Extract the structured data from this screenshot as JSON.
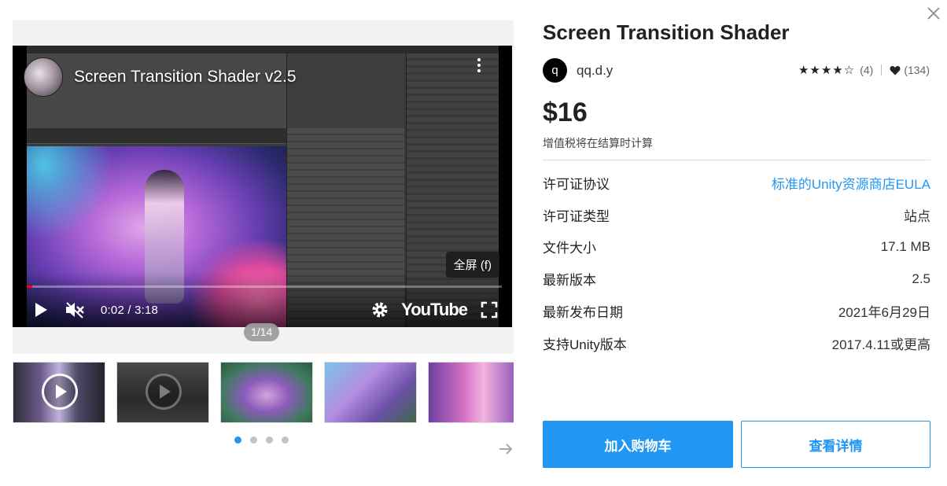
{
  "video": {
    "title": "Screen Transition Shader v2.5",
    "time": "0:02 / 3:18",
    "progress_fraction": 0.012,
    "brand": "YouTube",
    "fullscreen_tooltip": "全屏 (f)"
  },
  "gallery": {
    "counter": "1/14",
    "thumbnails": [
      {
        "kind": "video"
      },
      {
        "kind": "video"
      },
      {
        "kind": "image"
      },
      {
        "kind": "image"
      },
      {
        "kind": "image"
      }
    ],
    "page_dots": 4,
    "active_page": 0
  },
  "product": {
    "title": "Screen Transition Shader",
    "publisher_initial": "q",
    "publisher": "qq.d.y",
    "stars": "★★★★☆",
    "rating_count": "(4)",
    "favorites": "(134)",
    "price": "$16",
    "vat_note": "增值税将在结算时计算"
  },
  "specs": [
    {
      "key": "许可证协议",
      "value": "标准的Unity资源商店EULA",
      "link": true
    },
    {
      "key": "许可证类型",
      "value": "站点",
      "link": false
    },
    {
      "key": "文件大小",
      "value": "17.1 MB",
      "link": false
    },
    {
      "key": "最新版本",
      "value": "2.5",
      "link": false
    },
    {
      "key": "最新发布日期",
      "value": "2021年6月29日",
      "link": false
    },
    {
      "key": "支持Unity版本",
      "value": "2017.4.11或更高",
      "link": false
    }
  ],
  "actions": {
    "add_to_cart": "加入购物车",
    "view_details": "查看详情"
  },
  "colors": {
    "accent": "#2196f3",
    "progress_played": "#ff0000"
  },
  "icons": [
    "close-icon",
    "play-icon",
    "mute-icon",
    "settings-icon",
    "fullscreen-icon",
    "heart-icon",
    "arrow-right-icon",
    "kebab-menu-icon"
  ]
}
